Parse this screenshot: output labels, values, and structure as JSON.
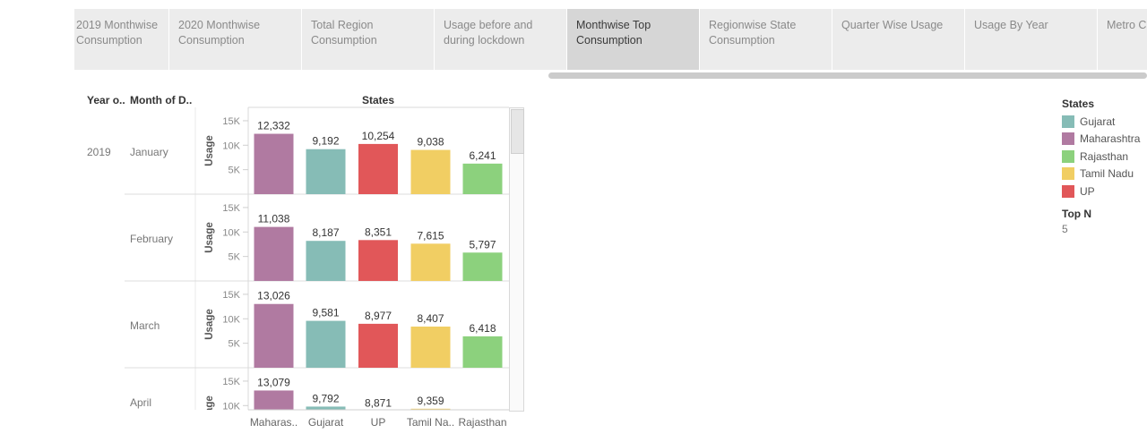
{
  "tabs": [
    {
      "label": "2019 Monthwise Consumption",
      "active": false
    },
    {
      "label": "2020 Monthwise Consumption",
      "active": false
    },
    {
      "label": "Total Region Consumption",
      "active": false
    },
    {
      "label": "Usage before and during lockdown",
      "active": false
    },
    {
      "label": "Monthwise Top Consumption",
      "active": true
    },
    {
      "label": "Regionwise State Consumption",
      "active": false
    },
    {
      "label": "Quarter Wise Usage",
      "active": false
    },
    {
      "label": "Usage By Year",
      "active": false
    },
    {
      "label": "Metro C",
      "active": false
    }
  ],
  "header": {
    "year_col": "Year o..",
    "month_col": "Month of D..",
    "states_col": "States"
  },
  "legend": {
    "title": "States",
    "items": [
      {
        "label": "Gujarat",
        "color": "#86bcb6"
      },
      {
        "label": "Maharashtra",
        "color": "#b07aa1"
      },
      {
        "label": "Rajasthan",
        "color": "#8cd17d"
      },
      {
        "label": "Tamil Nadu",
        "color": "#f1ce63"
      },
      {
        "label": "UP",
        "color": "#e15759"
      }
    ]
  },
  "filter": {
    "title": "Top N",
    "value": "5"
  },
  "chart_data": {
    "type": "bar",
    "year": "2019",
    "categories": [
      "Maharas..",
      "Gujarat",
      "UP",
      "Tamil Na..",
      "Rajasthan"
    ],
    "category_colors": [
      "#b07aa1",
      "#86bcb6",
      "#e15759",
      "#f1ce63",
      "#8cd17d"
    ],
    "ylabel": "Usage",
    "ylim": [
      0,
      17000
    ],
    "yticks": [
      5000,
      10000,
      15000
    ],
    "ytick_labels": [
      "5K",
      "10K",
      "15K"
    ],
    "panels": [
      {
        "month": "January",
        "values": [
          12332,
          9192,
          10254,
          9038,
          6241
        ],
        "labels": [
          "12,332",
          "9,192",
          "10,254",
          "9,038",
          "6,241"
        ]
      },
      {
        "month": "February",
        "values": [
          11038,
          8187,
          8351,
          7615,
          5797
        ],
        "labels": [
          "11,038",
          "8,187",
          "8,351",
          "7,615",
          "5,797"
        ]
      },
      {
        "month": "March",
        "values": [
          13026,
          9581,
          8977,
          8407,
          6418
        ],
        "labels": [
          "13,026",
          "9,581",
          "8,977",
          "8,407",
          "6,418"
        ]
      },
      {
        "month": "April",
        "values": [
          13079,
          9792,
          8871,
          9359
        ],
        "labels": [
          "13,079",
          "9,792",
          "8,871",
          "9,359"
        ]
      }
    ]
  }
}
